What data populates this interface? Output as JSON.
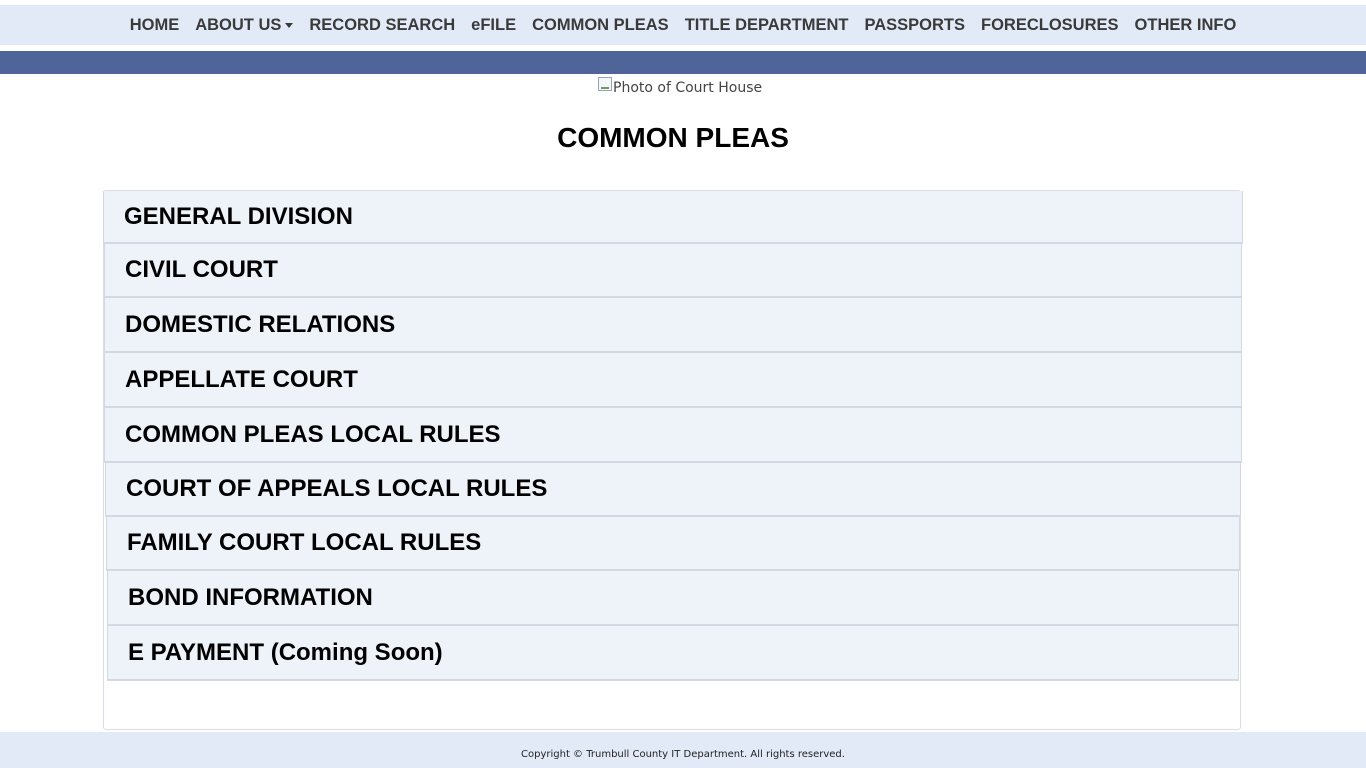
{
  "nav": {
    "items": [
      {
        "label": "HOME"
      },
      {
        "label": "ABOUT US",
        "dropdown": true
      },
      {
        "label": "RECORD SEARCH"
      },
      {
        "label": "eFILE"
      },
      {
        "label": "COMMON PLEAS"
      },
      {
        "label": "TITLE DEPARTMENT"
      },
      {
        "label": "PASSPORTS"
      },
      {
        "label": "FORECLOSURES"
      },
      {
        "label": "OTHER INFO"
      }
    ]
  },
  "banner": {
    "photo_alt": "Photo of Court House"
  },
  "page": {
    "title": "COMMON PLEAS"
  },
  "accordion": {
    "items": [
      {
        "label": "GENERAL DIVISION"
      },
      {
        "label": "CIVIL COURT"
      },
      {
        "label": "DOMESTIC RELATIONS"
      },
      {
        "label": "APPELLATE COURT"
      },
      {
        "label": "COMMON PLEAS LOCAL RULES"
      },
      {
        "label": "COURT OF APPEALS LOCAL RULES"
      },
      {
        "label": "FAMILY COURT LOCAL RULES"
      },
      {
        "label": "BOND INFORMATION"
      },
      {
        "label": "E PAYMENT (Coming Soon)"
      }
    ]
  },
  "footer": {
    "copyright": "Copyright © Trumbull County IT Department. All rights reserved."
  },
  "colors": {
    "nav_bg": "#e3eaf7",
    "band": "#4f6498",
    "item_bg": "#eef2f9"
  }
}
